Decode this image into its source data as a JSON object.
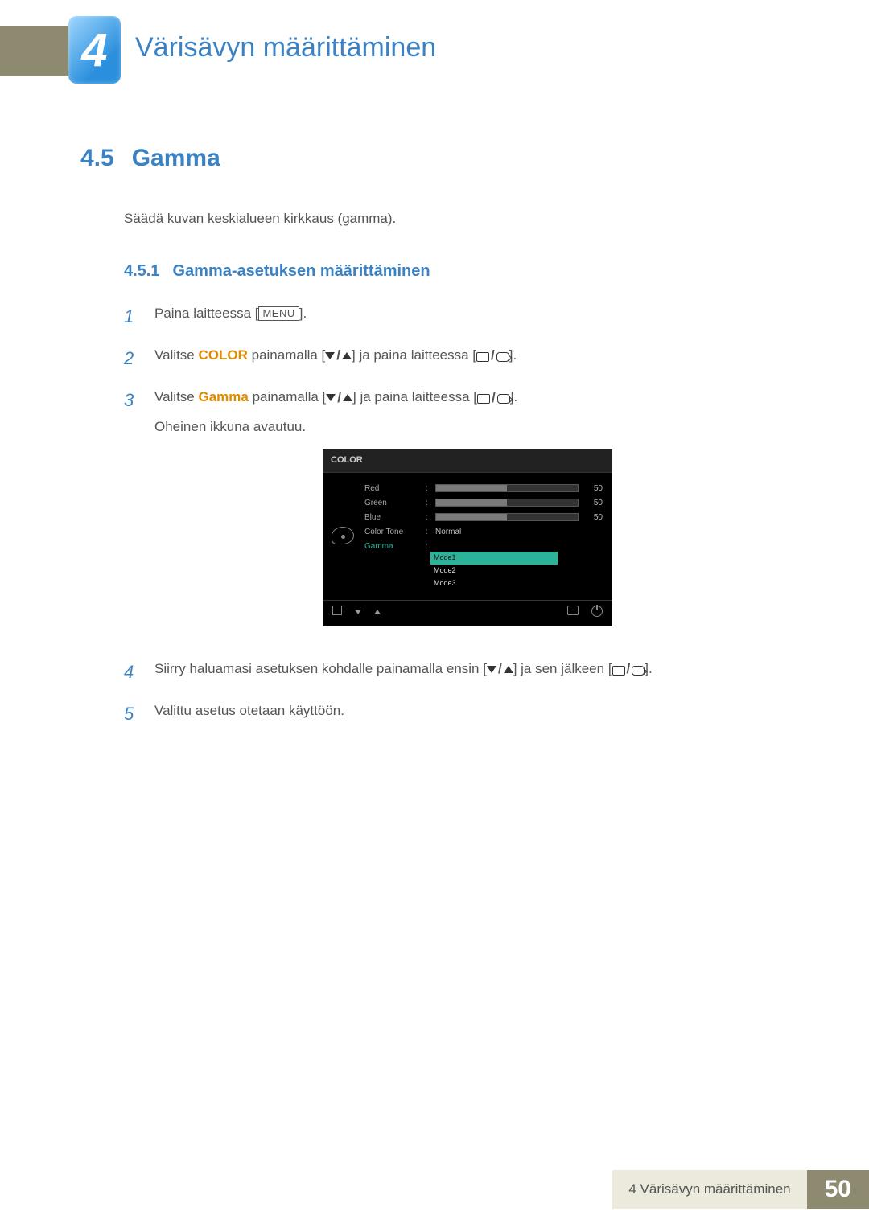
{
  "chapter": {
    "number": "4",
    "title": "Värisävyn määrittäminen"
  },
  "section": {
    "number": "4.5",
    "title": "Gamma",
    "intro": "Säädä kuvan keskialueen kirkkaus (gamma)."
  },
  "subsection": {
    "number": "4.5.1",
    "title": "Gamma-asetuksen määrittäminen"
  },
  "steps": [
    {
      "n": "1",
      "prefix": "Paina laitteessa [",
      "btn_label": "MENU",
      "suffix": "]."
    },
    {
      "n": "2",
      "prefix": "Valitse ",
      "emph": "COLOR",
      "mid1": " painamalla [",
      "mid2": "] ja paina laitteessa [",
      "suffix": "]."
    },
    {
      "n": "3",
      "prefix": "Valitse ",
      "emph": "Gamma",
      "mid1": " painamalla [",
      "mid2": "] ja paina laitteessa [",
      "suffix": "].",
      "line2": "Oheinen ikkuna avautuu."
    },
    {
      "n": "4",
      "prefix": "Siirry haluamasi asetuksen kohdalle painamalla ensin [",
      "mid2": "] ja sen jälkeen [",
      "suffix": "]."
    },
    {
      "n": "5",
      "prefix": "Valittu asetus otetaan käyttöön."
    }
  ],
  "osd": {
    "title": "COLOR",
    "rows": [
      {
        "label": "Red",
        "value": "50",
        "type": "bar"
      },
      {
        "label": "Green",
        "value": "50",
        "type": "bar"
      },
      {
        "label": "Blue",
        "value": "50",
        "type": "bar"
      },
      {
        "label": "Color Tone",
        "text": "Normal",
        "type": "text"
      },
      {
        "label": "Gamma",
        "type": "modes",
        "highlight": true
      }
    ],
    "modes": [
      "Mode1",
      "Mode2",
      "Mode3"
    ],
    "selected_mode": "Mode1"
  },
  "footer": {
    "text": "4 Värisävyn määrittäminen",
    "page": "50"
  }
}
